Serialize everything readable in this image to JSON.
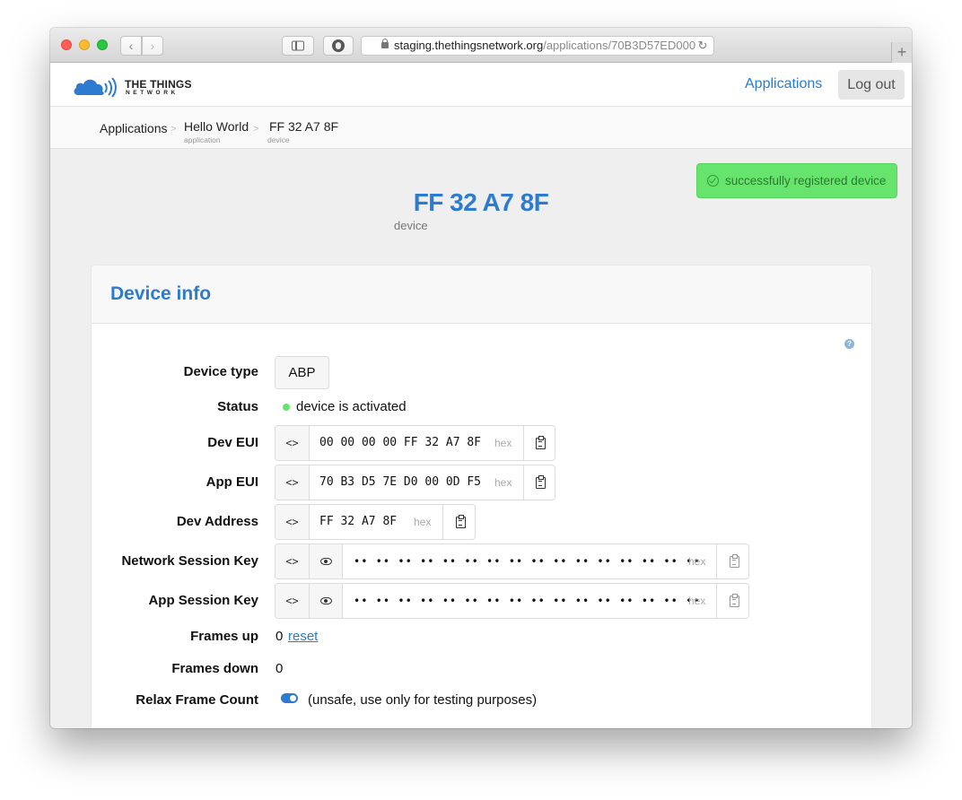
{
  "browser": {
    "url_domain": "staging.thethingsnetwork.org",
    "url_path": "/applications/70B3D57ED000",
    "reload_glyph": "↻",
    "back_glyph": "‹",
    "forward_glyph": "›",
    "new_tab_glyph": "+"
  },
  "header": {
    "logo_line1": "THE THINGS",
    "logo_line2": "NETWORK",
    "nav_applications": "Applications",
    "logout": "Log out"
  },
  "breadcrumbs": [
    {
      "label": "Applications",
      "sub": ""
    },
    {
      "label": "Hello World",
      "sub": "application"
    },
    {
      "label": "FF 32 A7 8F",
      "sub": "device"
    }
  ],
  "breadcrumb_separator": ">",
  "toast": {
    "message": "successfully registered device",
    "color": "#66e46d"
  },
  "device": {
    "title": "FF 32 A7 8F",
    "subtitle": "device"
  },
  "card": {
    "title": "Device info",
    "help": "?",
    "device_type": {
      "label": "Device type",
      "value": "ABP"
    },
    "status": {
      "label": "Status",
      "value": "device is activated"
    },
    "dev_eui": {
      "label": "Dev EUI",
      "value": "00 00 00 00 FF 32 A7 8F",
      "unit": "hex"
    },
    "app_eui": {
      "label": "App EUI",
      "value": "70 B3 D5 7E D0 00 0D F5",
      "unit": "hex"
    },
    "dev_address": {
      "label": "Dev Address",
      "value": "FF 32 A7 8F",
      "unit": "hex"
    },
    "nwk_skey": {
      "label": "Network Session Key",
      "value": "•• •• •• •• •• •• •• •• •• •• •• •• •• •• •• ••",
      "unit": "hex"
    },
    "app_skey": {
      "label": "App Session Key",
      "value": "•• •• •• •• •• •• •• •• •• •• •• •• •• •• •• ••",
      "unit": "hex"
    },
    "frames_up": {
      "label": "Frames up",
      "value": "0",
      "action": "reset"
    },
    "frames_down": {
      "label": "Frames down",
      "value": "0"
    },
    "relax_frame_count": {
      "label": "Relax Frame Count",
      "note": "(unsafe, use only for testing purposes)",
      "enabled": true
    },
    "toggle_glyph": "<>"
  },
  "colors": {
    "accent": "#2c7bd0",
    "success": "#66e46d"
  }
}
